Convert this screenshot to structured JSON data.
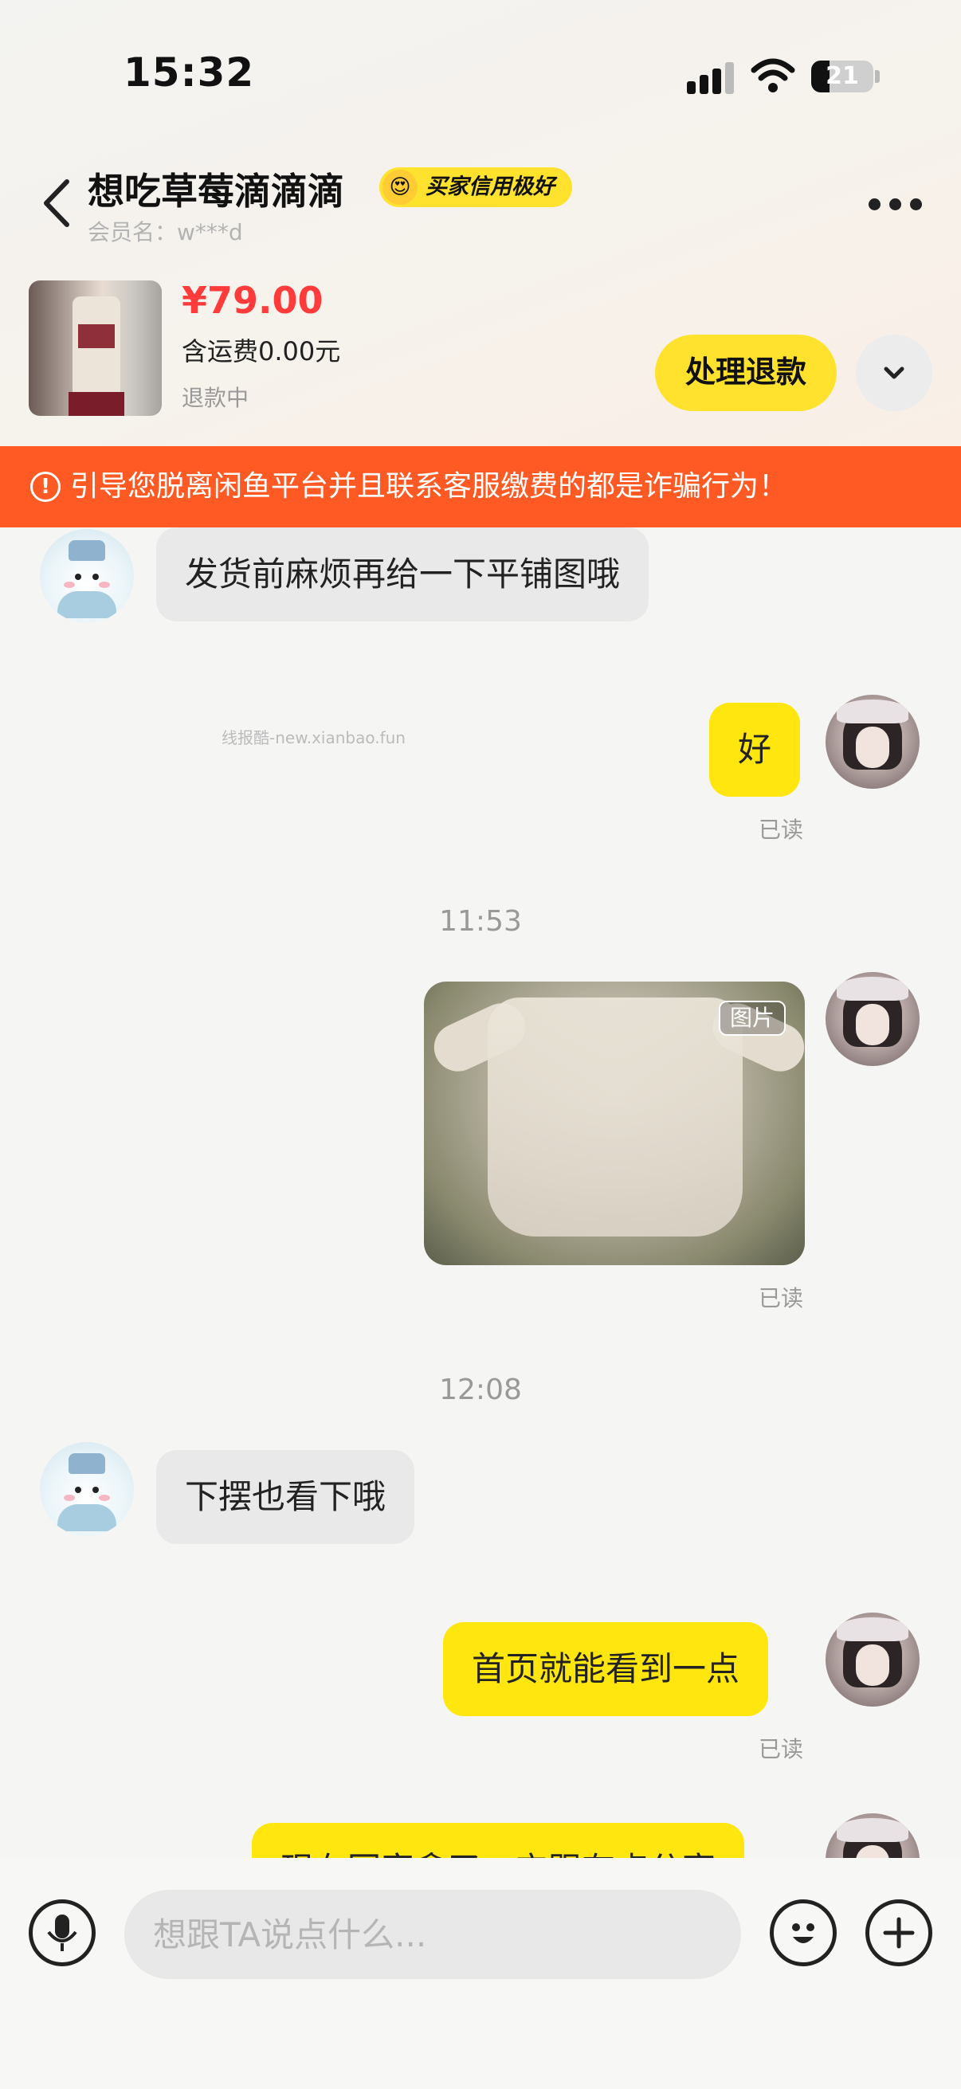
{
  "status_bar": {
    "time": "15:32",
    "battery": "21"
  },
  "header": {
    "title": "想吃草莓滴滴滴",
    "badge": "买家信用极好",
    "badge_emoji": "😍",
    "member": "会员名：w***d"
  },
  "product": {
    "price": "¥79.00",
    "shipping": "含运费0.00元",
    "status": "退款中",
    "refund_button": "处理退款"
  },
  "warning": "引导您脱离闲鱼平台并且联系客服缴费的都是诈骗行为！",
  "chat": {
    "watermark": "线报酷-new.xianbao.fun",
    "messages": [
      {
        "text": "发货前麻烦再给一下平铺图哦"
      },
      {
        "text": "好",
        "read": "已读"
      },
      {
        "time": "11:53"
      },
      {
        "image_tag": "图片",
        "read": "已读"
      },
      {
        "time": "12:08"
      },
      {
        "text": "下摆也看下哦"
      },
      {
        "text": "首页就能看到一点",
        "read": "已读"
      },
      {
        "text": "现在回家拿了，它跟有点分享"
      }
    ]
  },
  "input": {
    "placeholder": "想跟TA说点什么..."
  }
}
